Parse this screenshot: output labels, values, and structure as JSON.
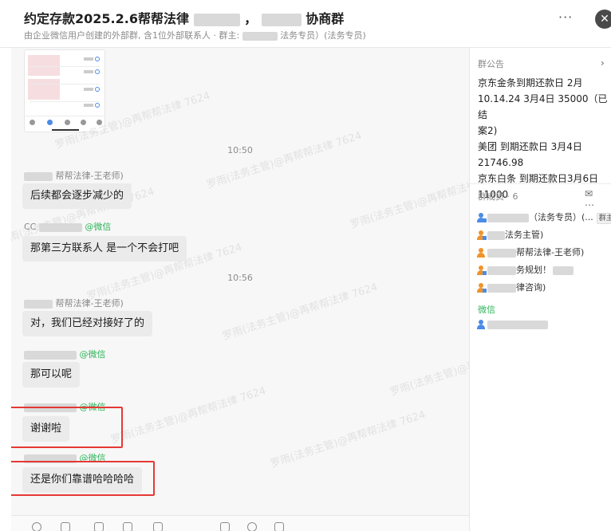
{
  "header": {
    "title_part1": "约定存款2025.2.6帮帮法律",
    "title_sep": "，",
    "title_part2": "协商群",
    "subtitle_prefix": "由企业微信用户创建的外部群, 含1位外部联系人 · 群主:",
    "subtitle_suffix": "法务专员）(法务专员)",
    "more_icon": "···",
    "close_icon": "✕"
  },
  "chat": {
    "messages": [
      {
        "type": "time",
        "text": "10:50"
      },
      {
        "type": "sender",
        "name": "帮帮法律-王老师)",
        "wechat": ""
      },
      {
        "type": "bubble",
        "text": "后续都会逐步减少的"
      },
      {
        "type": "sender",
        "name": "CC",
        "wechat": "@微信"
      },
      {
        "type": "bubble",
        "text": "那第三方联系人 是一个不会打吧"
      },
      {
        "type": "time",
        "text": "10:56"
      },
      {
        "type": "sender",
        "name": "帮帮法律-王老师)",
        "wechat": ""
      },
      {
        "type": "bubble",
        "text": "对，我们已经对接好了的"
      },
      {
        "type": "sender",
        "name": "",
        "wechat": "@微信"
      },
      {
        "type": "bubble",
        "text": "那可以呢"
      },
      {
        "type": "sender",
        "name": "",
        "wechat": "@微信"
      },
      {
        "type": "bubble",
        "text": "谢谢啦"
      },
      {
        "type": "sender",
        "name": "",
        "wechat": "@微信"
      },
      {
        "type": "bubble",
        "text": "还是你们靠谱哈哈哈哈"
      }
    ],
    "watermark": "罗雨(法务主管)@再帮帮法律 7624"
  },
  "panel": {
    "notice_title": "群公告",
    "notice_arrow": "›",
    "notice_lines": [
      "京东金条到期还款日 2月",
      "10.14.24 3月4日 35000（已结",
      "案2)",
      "美团 到期还款日 3月4日",
      "21746.98",
      "京东白条 到期还款日3月6日",
      "11000"
    ],
    "members_title": "群成员 · 6",
    "members_icons": "✉ ⋯",
    "members": [
      {
        "name": "（法务专员）(...",
        "tag": "群主",
        "color": "#4b8be6"
      },
      {
        "name": "法务主管)",
        "tag": "",
        "color": "#f0932b"
      },
      {
        "name": "帮帮法律-王老师)",
        "tag": "",
        "color": "#f0932b"
      },
      {
        "name": "务规划！",
        "tag": "",
        "color": "#f0932b"
      },
      {
        "name": "律咨询)",
        "tag": "",
        "color": "#f0932b"
      }
    ],
    "wechat_label": "微信",
    "wechat_member": {
      "name": "",
      "color": "#4b8be6"
    }
  }
}
